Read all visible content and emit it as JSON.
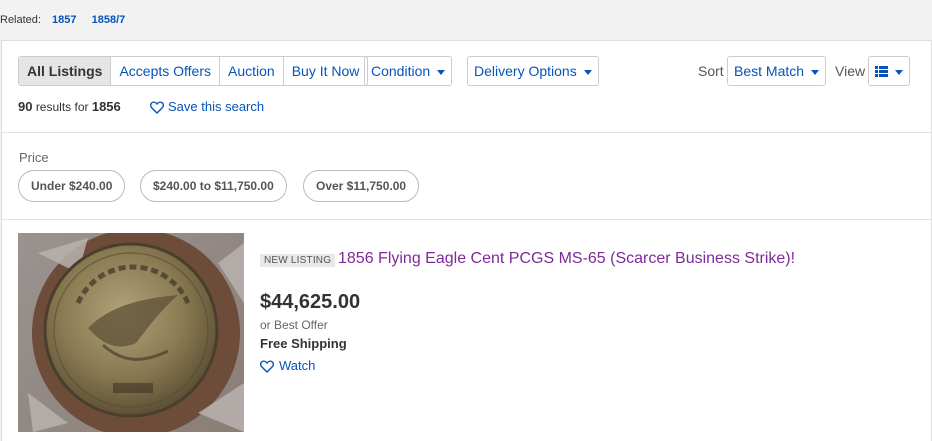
{
  "related": {
    "label": "Related:",
    "links": [
      "1857",
      "1858/7"
    ]
  },
  "tabs": [
    "All Listings",
    "Accepts Offers",
    "Auction",
    "Buy It Now"
  ],
  "filters": {
    "condition": "Condition",
    "delivery": "Delivery Options"
  },
  "sort": {
    "label": "Sort",
    "value": "Best Match"
  },
  "view": {
    "label": "View",
    "icon": "list-view-icon"
  },
  "results": {
    "count": "90",
    "text": "results for",
    "query": "1856"
  },
  "save_search": "Save this search",
  "price_filter": {
    "label": "Price",
    "options": [
      "Under $240.00",
      "$240.00 to $11,750.00",
      "Over $11,750.00"
    ]
  },
  "listing": {
    "badge": "NEW LISTING",
    "title": "1856 Flying Eagle Cent PCGS MS-65 (Scarcer Business Strike)!",
    "price": "$44,625.00",
    "best_offer": "or Best Offer",
    "shipping": "Free Shipping",
    "watch": "Watch"
  },
  "colors": {
    "link": "#0654ba",
    "title_visited": "#7f2a98"
  }
}
